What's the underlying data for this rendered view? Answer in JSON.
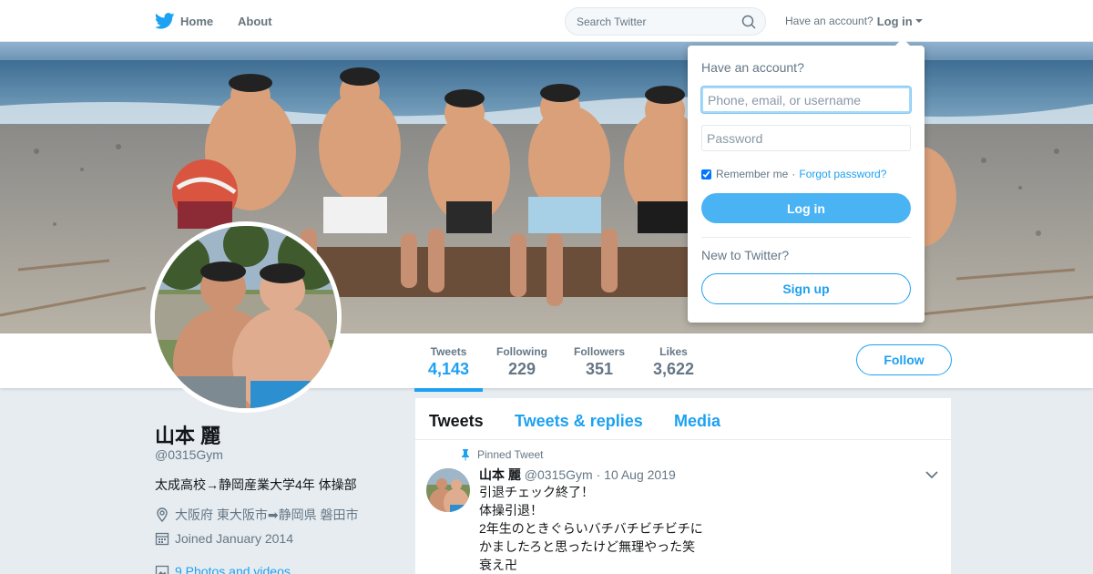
{
  "nav": {
    "home_label": "Home",
    "about_label": "About",
    "search_placeholder": "Search Twitter",
    "have_account": "Have an account?",
    "login_label": "Log in",
    "icons": {
      "logo": "twitter-bird-icon",
      "search": "search-icon",
      "caret": "caret-down-icon"
    }
  },
  "profile": {
    "name": "山本 麗",
    "handle": "@0315Gym",
    "bio": "太成高校→静岡産業大学4年 体操部",
    "location": "大阪府 東大阪市➡静岡県 磐田市",
    "joined": "Joined January 2014",
    "photos_link": "9 Photos and videos"
  },
  "stats": [
    {
      "label": "Tweets",
      "value": "4,143",
      "active": true
    },
    {
      "label": "Following",
      "value": "229"
    },
    {
      "label": "Followers",
      "value": "351"
    },
    {
      "label": "Likes",
      "value": "3,622"
    }
  ],
  "follow_label": "Follow",
  "timeline": {
    "tabs": [
      {
        "label": "Tweets",
        "active": true
      },
      {
        "label": "Tweets & replies"
      },
      {
        "label": "Media"
      }
    ],
    "pinned_tweet": {
      "pinned_label": "Pinned Tweet",
      "author_name": "山本 麗",
      "author_handle": "@0315Gym",
      "separator": "·",
      "date": "10 Aug 2019",
      "lines": [
        "引退チェック終了！",
        "体操引退！",
        "2年生のときぐらいバチバチビチビチに",
        "かましたろと思ったけど無理やった笑",
        "衰え卍"
      ]
    }
  },
  "login_dropdown": {
    "title": "Have an account?",
    "username_placeholder": "Phone, email, or username",
    "password_placeholder": "Password",
    "remember_label": "Remember me",
    "separator": "·",
    "forgot_label": "Forgot password?",
    "login_button": "Log in",
    "new_label": "New to Twitter?",
    "signup_button": "Sign up"
  },
  "colors": {
    "accent": "#1da1f2",
    "login_button": "#4ab3f4",
    "page_bg": "#e6ecf0",
    "muted_text": "#657786"
  }
}
